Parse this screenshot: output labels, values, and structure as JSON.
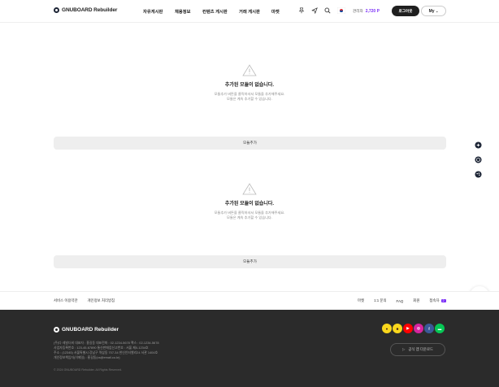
{
  "header": {
    "logo_text": "GNUBOARD Rebuilder",
    "nav": [
      "자유게시판",
      "채용정보",
      "컨텐츠 게시판",
      "거래 게시판",
      "마켓"
    ],
    "points_label": "관리자",
    "points_value": "2,720 P",
    "login_label": "로그아웃",
    "my_label": "My",
    "icons": [
      "pin-icon",
      "send-icon",
      "search-icon",
      "korea-flag-icon"
    ]
  },
  "main": {
    "empty_title": "추가된 모듈이 없습니다.",
    "empty_desc_1": "모듈추가 버튼을 클릭하셔서 모듈을 추가해주세요.",
    "empty_desc_2": "모듈은 계속 추가할 수 있습니다.",
    "add_button": "모듈추가",
    "empty_title_2": "추가된 모듈이 없습니다.",
    "empty_desc_2_1": "모듈추가 버튼을 클릭하셔서 모듈을 추가해주세요.",
    "empty_desc_2_2": "모듈은 계속 추가할 수 있습니다.",
    "add_button_2": "모듈추가"
  },
  "footer_links": {
    "left": [
      "서비스 이용약관",
      "개인정보 처리방침"
    ],
    "right": [
      "마켓",
      "1:1 문의",
      "FAQ",
      "회원",
      "접속자"
    ],
    "visitor_count": "2"
  },
  "footer": {
    "logo_text": "GNUBOARD Rebuilder",
    "line1": "(주)다 레빌더비   대표자 : 홍길동   대표전화 : 02-1234-5678   팩스 : 02-1234-5678",
    "line2": "사업자등록번호 : 123-45-67890   통신판매업신고번호 : 서울 제0-1234호",
    "line3": "주소 : (12345) 서울특별시 강남구 역삼동 707-34 한신인터밸리24 서관 1404호",
    "line4": "개인정보책임자(이메일) : 홍길동(cs@email.co.kr)",
    "copyright": "© 2024 GNUBOARD Rebuilder. All Rights Reserved.",
    "app_button": "공식 앱 다운로드",
    "social": [
      "kakaotalk",
      "kakaostory",
      "youtube",
      "instagram",
      "facebook",
      "line"
    ],
    "colors": {
      "kakao": "#f9d71c",
      "youtube": "#ff0000",
      "instagram": "#d6249f",
      "facebook": "#3b5998",
      "line": "#06c755"
    }
  }
}
